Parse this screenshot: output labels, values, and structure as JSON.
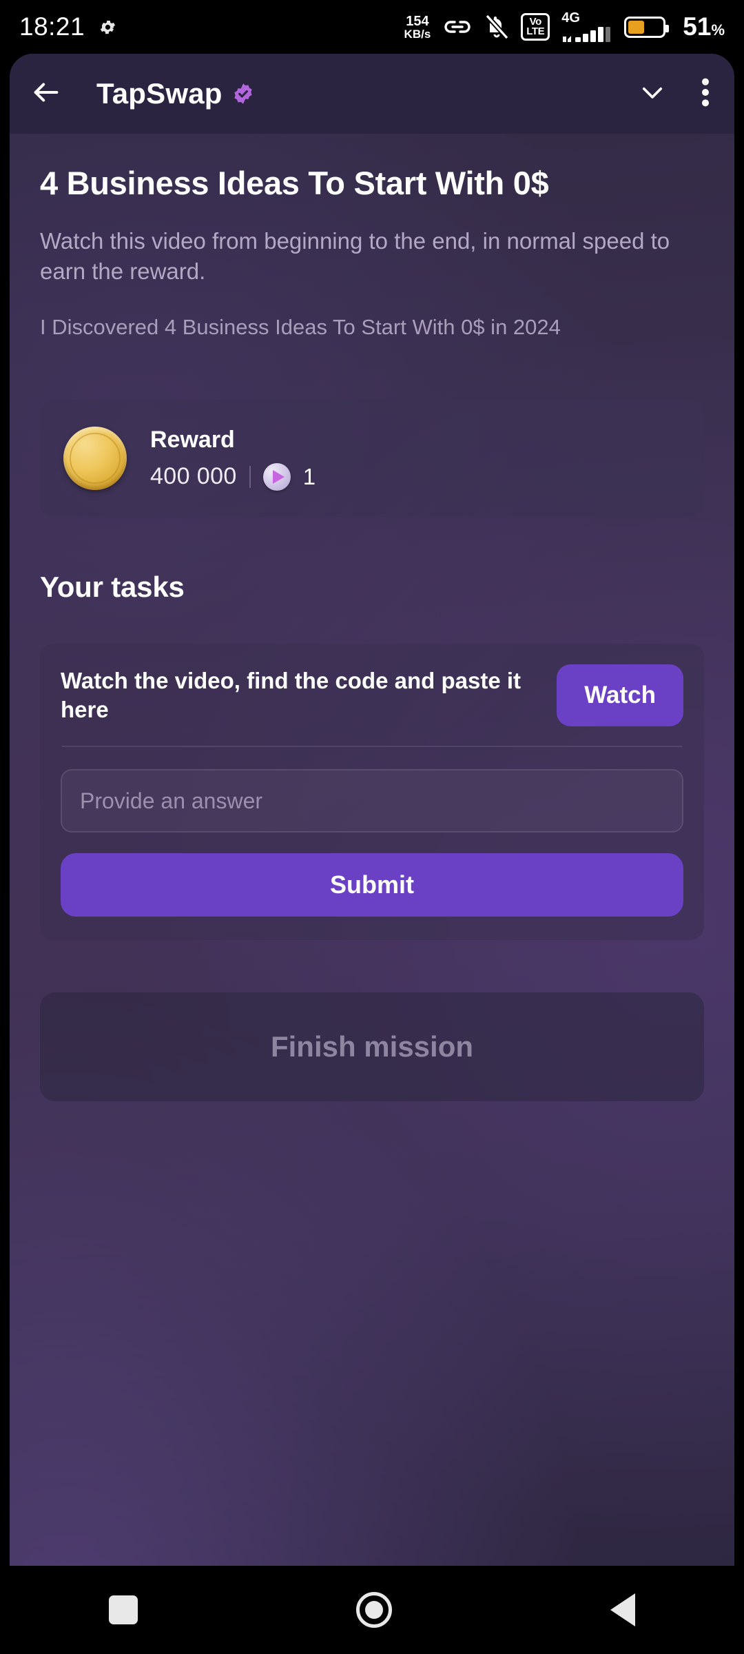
{
  "status_bar": {
    "time": "18:21",
    "gear_icon": "gear-icon",
    "net_speed_value": "154",
    "net_speed_unit": "KB/s",
    "link_icon": "link-icon",
    "mute_icon": "bell-muted-icon",
    "volte_line1": "Vo",
    "volte_line2": "LTE",
    "network_type": "4G",
    "signal_icon": "signal-bars-icon",
    "battery_icon": "battery-icon",
    "battery_percent": "51",
    "battery_percent_symbol": "%",
    "battery_color": "#E8A020"
  },
  "appbar": {
    "back_icon": "back-arrow-icon",
    "app_name": "TapSwap",
    "verified_icon": "verified-badge-icon",
    "verified_color": "#B266DD",
    "collapse_icon": "chevron-down-icon",
    "menu_icon": "more-vertical-icon"
  },
  "mission": {
    "title": "4 Business Ideas To Start With 0$",
    "description": "Watch this video from beginning to the end, in normal speed to earn the reward.",
    "subtitle": "I Discovered 4 Business Ideas To Start With 0$ in 2024"
  },
  "reward": {
    "coin_icon": "gold-coin-icon",
    "label": "Reward",
    "amount": "400 000",
    "play_icon": "play-badge-icon",
    "count": "1"
  },
  "tasks": {
    "section_title": "Your tasks",
    "task_text": "Watch the video, find the code and paste it here",
    "watch_button": "Watch",
    "answer_placeholder": "Provide an answer",
    "answer_value": "",
    "submit_button": "Submit"
  },
  "footer": {
    "finish_button": "Finish mission"
  },
  "nav_bar": {
    "recents_icon": "recents-square-icon",
    "home_icon": "home-circle-icon",
    "back_icon": "back-triangle-icon"
  },
  "theme": {
    "accent": "#6A40C4",
    "appbar_bg": "#2B2440",
    "coin_gold": "#EFC75C"
  }
}
